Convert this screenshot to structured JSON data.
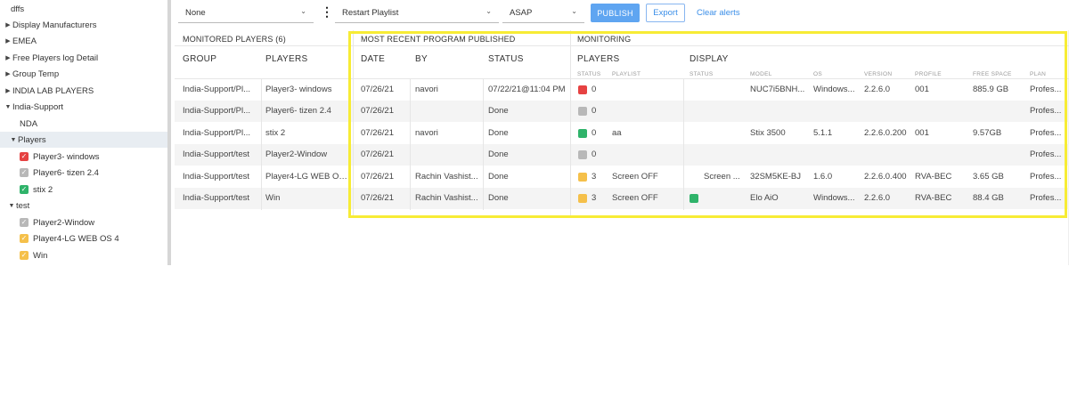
{
  "sidebar": {
    "items": [
      {
        "label": "dffs",
        "caret": "",
        "check": ""
      },
      {
        "label": "Display Manufacturers",
        "caret": "▶",
        "check": ""
      },
      {
        "label": "EMEA",
        "caret": "▶",
        "check": ""
      },
      {
        "label": "Free Players log Detail",
        "caret": "▶",
        "check": ""
      },
      {
        "label": "Group Temp",
        "caret": "▶",
        "check": ""
      },
      {
        "label": "INDIA LAB PLAYERS",
        "caret": "▶",
        "check": ""
      },
      {
        "label": "India-Support",
        "caret": "▼",
        "check": ""
      },
      {
        "label": "NDA",
        "caret": "",
        "check": ""
      },
      {
        "label": "Players",
        "caret": "▼",
        "check": ""
      },
      {
        "label": "Player3- windows",
        "caret": "",
        "check": "red"
      },
      {
        "label": "Player6- tizen 2.4",
        "caret": "",
        "check": "grey"
      },
      {
        "label": "stix 2",
        "caret": "",
        "check": "green"
      },
      {
        "label": "test",
        "caret": "▼",
        "check": ""
      },
      {
        "label": "Player2-Window",
        "caret": "",
        "check": "grey"
      },
      {
        "label": "Player4-LG WEB OS 4",
        "caret": "",
        "check": "yellow"
      },
      {
        "label": "Win",
        "caret": "",
        "check": "yellow"
      }
    ]
  },
  "toolbar": {
    "filter_value": "None",
    "action_value": "Restart Playlist",
    "timing_value": "ASAP",
    "publish_label": "PUBLISH",
    "export_label": "Export",
    "clear_label": "Clear alerts"
  },
  "table": {
    "group_headers": {
      "monitored": "MONITORED PLAYERS (6)",
      "recent": "MOST RECENT PROGRAM PUBLISHED",
      "monitoring": "MONITORING"
    },
    "columns": {
      "group": "GROUP",
      "players": "PLAYERS",
      "date": "DATE",
      "by": "BY",
      "status": "STATUS",
      "mon_players": "PLAYERS",
      "display": "DISPLAY"
    },
    "sub_columns": {
      "p_status": "STATUS",
      "playlist": "PLAYLIST",
      "d_status": "STATUS",
      "model": "MODEL",
      "os": "OS",
      "version": "VERSION",
      "profile": "PROFILE",
      "free_space": "FREE SPACE",
      "plan": "PLAN"
    },
    "rows": [
      {
        "group": "India-Support/Pl...",
        "player": "Player3- windows",
        "date": "07/26/21",
        "by": "navori",
        "status": "07/22/21@11:04 PM",
        "p_color": "#e64242",
        "p_count": "0",
        "playlist": "",
        "d_color": "",
        "d_status": "",
        "model": "NUC7i5BNH...",
        "os": "Windows...",
        "version": "2.2.6.0",
        "profile": "001",
        "free_space": "885.9 GB",
        "plan": "Profes..."
      },
      {
        "group": "India-Support/Pl...",
        "player": "Player6- tizen 2.4",
        "date": "07/26/21",
        "by": "",
        "status": "Done",
        "p_color": "#b8b8b8",
        "p_count": "0",
        "playlist": "",
        "d_color": "",
        "d_status": "",
        "model": "",
        "os": "",
        "version": "",
        "profile": "",
        "free_space": "",
        "plan": "Profes..."
      },
      {
        "group": "India-Support/Pl...",
        "player": "stix 2",
        "date": "07/26/21",
        "by": "navori",
        "status": "Done",
        "p_color": "#2fb36a",
        "p_count": "0",
        "playlist": "aa",
        "d_color": "",
        "d_status": "",
        "model": "Stix 3500",
        "os": "5.1.1",
        "version": "2.2.6.0.200",
        "profile": "001",
        "free_space": "9.57GB",
        "plan": "Profes..."
      },
      {
        "group": "India-Support/test",
        "player": "Player2-Window",
        "date": "07/26/21",
        "by": "",
        "status": "Done",
        "p_color": "#b8b8b8",
        "p_count": "0",
        "playlist": "",
        "d_color": "",
        "d_status": "",
        "model": "",
        "os": "",
        "version": "",
        "profile": "",
        "free_space": "",
        "plan": "Profes..."
      },
      {
        "group": "India-Support/test",
        "player": "Player4-LG WEB OS 4",
        "date": "07/26/21",
        "by": "Rachin Vashist...",
        "status": "Done",
        "p_color": "#f5c04a",
        "p_count": "3",
        "playlist": "Screen OFF",
        "d_color": "",
        "d_status": "Screen ...",
        "model": "32SM5KE-BJ",
        "os": "1.6.0",
        "version": "2.2.6.0.400",
        "profile": "RVA-BEC",
        "free_space": "3.65 GB",
        "plan": "Profes..."
      },
      {
        "group": "India-Support/test",
        "player": "Win",
        "date": "07/26/21",
        "by": "Rachin Vashist...",
        "status": "Done",
        "p_color": "#f5c04a",
        "p_count": "3",
        "playlist": "Screen OFF",
        "d_color": "#2fb36a",
        "d_status": "",
        "model": "Elo AiO",
        "os": "Windows...",
        "version": "2.2.6.0",
        "profile": "RVA-BEC",
        "free_space": "88.4 GB",
        "plan": "Profes..."
      }
    ]
  },
  "colors": {
    "accent": "#5fa5f1",
    "link": "#3a8ee8",
    "highlight": "#f7ec35",
    "status_red": "#e64242",
    "status_grey": "#b8b8b8",
    "status_green": "#2fb36a",
    "status_yellow": "#f5c04a"
  }
}
